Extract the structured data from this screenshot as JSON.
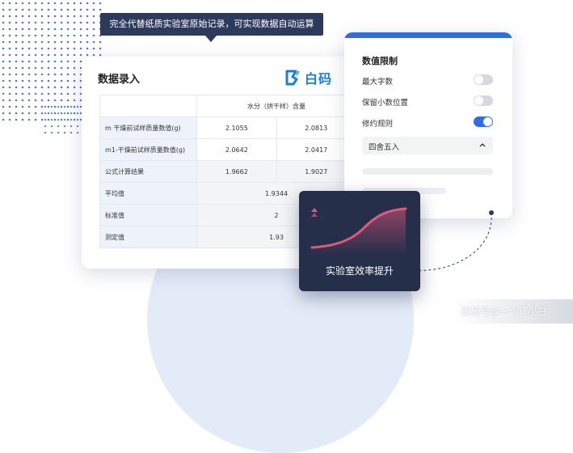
{
  "banner": {
    "text": "完全代替纸质实验室原始记录，可实现数据自动运算"
  },
  "entry_card": {
    "title": "数据录入",
    "logo_text": "白码",
    "brand_color": "#1b7fd6",
    "table": {
      "header": "水分（烘干样）含量",
      "rows": [
        {
          "label": "m 干燥前试样质量数值(g)",
          "v1": "2.1055",
          "v2": "2.0813"
        },
        {
          "label": "m1-干燥前试样质量数值(g)",
          "v1": "2.0642",
          "v2": "2.0417"
        },
        {
          "label": "公式计算结果",
          "v1": "1.9662",
          "v2": "1.9027"
        }
      ],
      "merged_rows": [
        {
          "label": "平均值",
          "value": "1.9344"
        },
        {
          "label": "标准值",
          "value": "2"
        },
        {
          "label": "测定值",
          "value": "1.93"
        }
      ]
    }
  },
  "limit_panel": {
    "title": "数值限制",
    "accent": "#2e6de8",
    "options": [
      {
        "label": "最大字数",
        "on": false
      },
      {
        "label": "保留小数位置",
        "on": false
      },
      {
        "label": "修约规则",
        "on": true
      }
    ],
    "rule_select": {
      "value": "四舍五入"
    }
  },
  "efficiency_card": {
    "label": "实验室效率提升",
    "curve_color": "#e2577a"
  },
  "watermark": "搜狐号@一个IT小白"
}
